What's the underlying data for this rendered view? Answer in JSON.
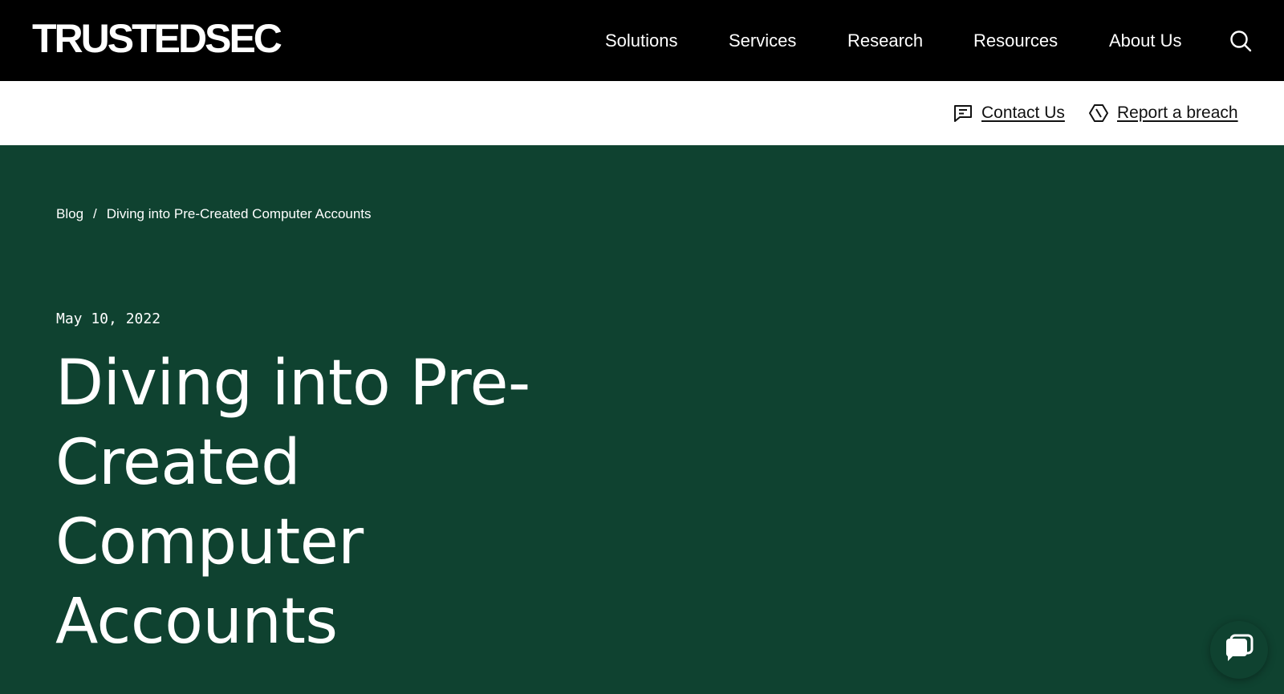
{
  "header": {
    "logo_text": "TRUSTEDSEC",
    "nav": [
      "Solutions",
      "Services",
      "Research",
      "Resources",
      "About Us"
    ],
    "search_icon": "search-icon"
  },
  "utility": {
    "contact_label": "Contact Us",
    "contact_icon": "message-square-icon",
    "breach_label": "Report a breach",
    "breach_icon": "alert-hexagon-icon"
  },
  "hero": {
    "breadcrumb": {
      "root": "Blog",
      "separator": "/",
      "current": "Diving into Pre-Created Computer Accounts"
    },
    "date": "May 10, 2022",
    "title": "Diving into Pre-Created Computer Accounts"
  },
  "chat": {
    "icon": "chat-bubble-icon"
  },
  "colors": {
    "header_bg": "#000000",
    "hero_bg": "#0f4230",
    "text_light": "#ffffff",
    "text_dark": "#111111"
  }
}
